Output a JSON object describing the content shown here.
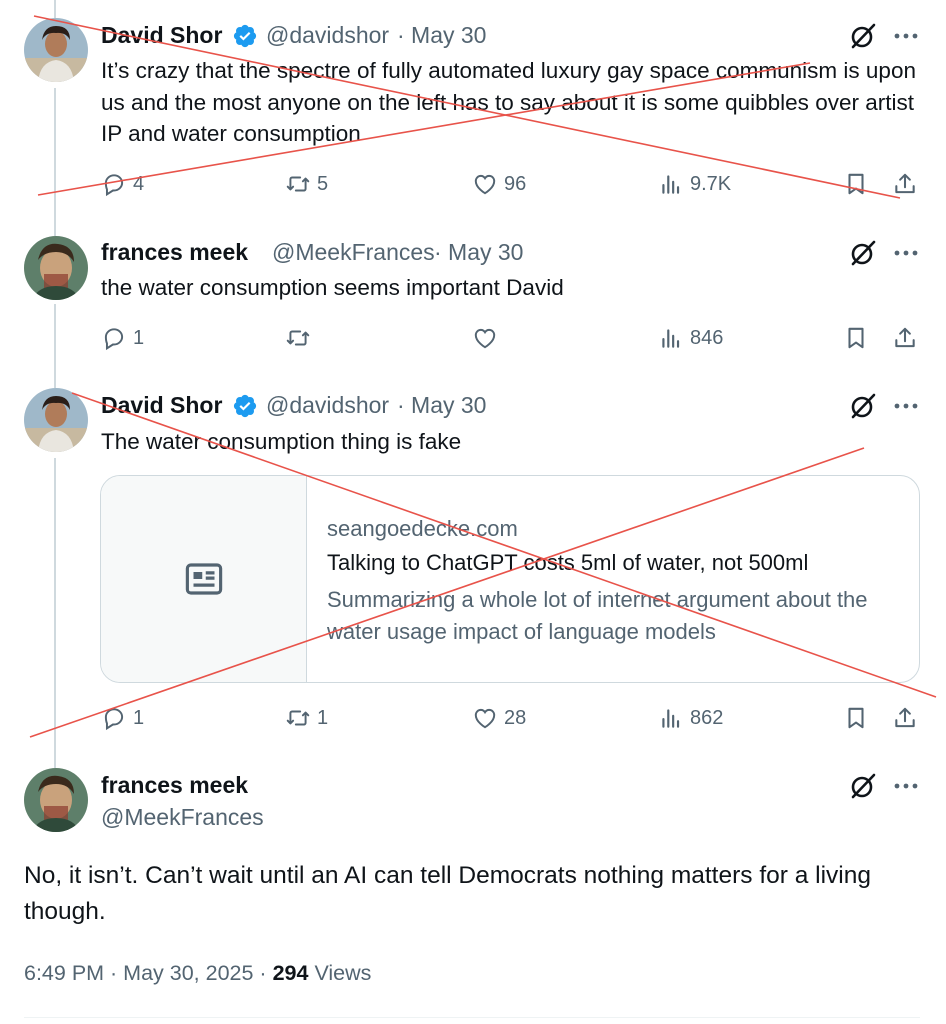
{
  "tweets": [
    {
      "name": "David Shor",
      "verified": true,
      "handle": "@davidshor",
      "date": "· May 30",
      "text": "It’s crazy that the spectre of fully automated luxury gay space communism is upon us and the most anyone on the left has to say about it is some quibbles over artist IP and water consumption",
      "replies": "4",
      "retweets": "5",
      "likes": "96",
      "views": "9.7K"
    },
    {
      "name": "frances meek",
      "verified": false,
      "handle": "@MeekFrances",
      "date": "· May 30",
      "text": "the water consumption seems important David",
      "replies": "1",
      "retweets": "",
      "likes": "",
      "views": "846"
    },
    {
      "name": "David Shor",
      "verified": true,
      "handle": "@davidshor",
      "date": "· May 30",
      "text": "The water consumption thing is fake",
      "card": {
        "domain": "seangoedecke.com",
        "title": "Talking to ChatGPT costs 5ml of water, not 500ml",
        "description": "Summarizing a whole lot of internet argument about the water usage impact of language models"
      },
      "replies": "1",
      "retweets": "1",
      "likes": "28",
      "views": "862"
    }
  ],
  "main": {
    "name": "frances meek",
    "handle": "@MeekFrances",
    "text": "No, it isn’t. Can’t wait until an AI can tell Democrats nothing matters for a living though.",
    "time": "6:49 PM · May 30, 2025 ·",
    "views_count": "294",
    "views_label": "Views"
  },
  "colors": {
    "accent_blue": "#1d9bf0",
    "muted_text": "#536471",
    "strike_red": "#e8534a"
  },
  "icons": [
    "verified-badge-icon",
    "grok-icon",
    "more-icon",
    "reply-icon",
    "retweet-icon",
    "like-icon",
    "views-icon",
    "bookmark-icon",
    "share-icon",
    "article-icon"
  ]
}
